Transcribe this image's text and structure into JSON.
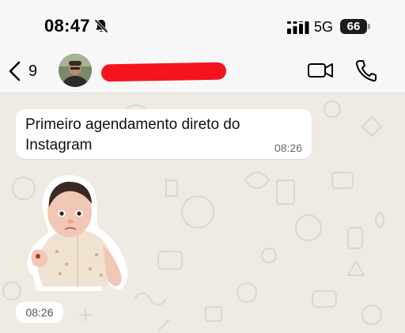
{
  "status_bar": {
    "time": "08:47",
    "network": "5G",
    "battery": "66",
    "icons": [
      "bell-slash-icon",
      "signal-bars-icon"
    ]
  },
  "header": {
    "back_count": "9",
    "icons": [
      "chevron-left-icon",
      "video-camera-icon",
      "phone-icon"
    ]
  },
  "messages": [
    {
      "type": "text",
      "text": "Primeiro agendamento direto do Instagram",
      "time": "08:26"
    },
    {
      "type": "sticker",
      "time": "08:26"
    }
  ],
  "colors": {
    "chat_background": "#efeae2",
    "bubble": "#ffffff",
    "redaction": "#f5141e"
  }
}
